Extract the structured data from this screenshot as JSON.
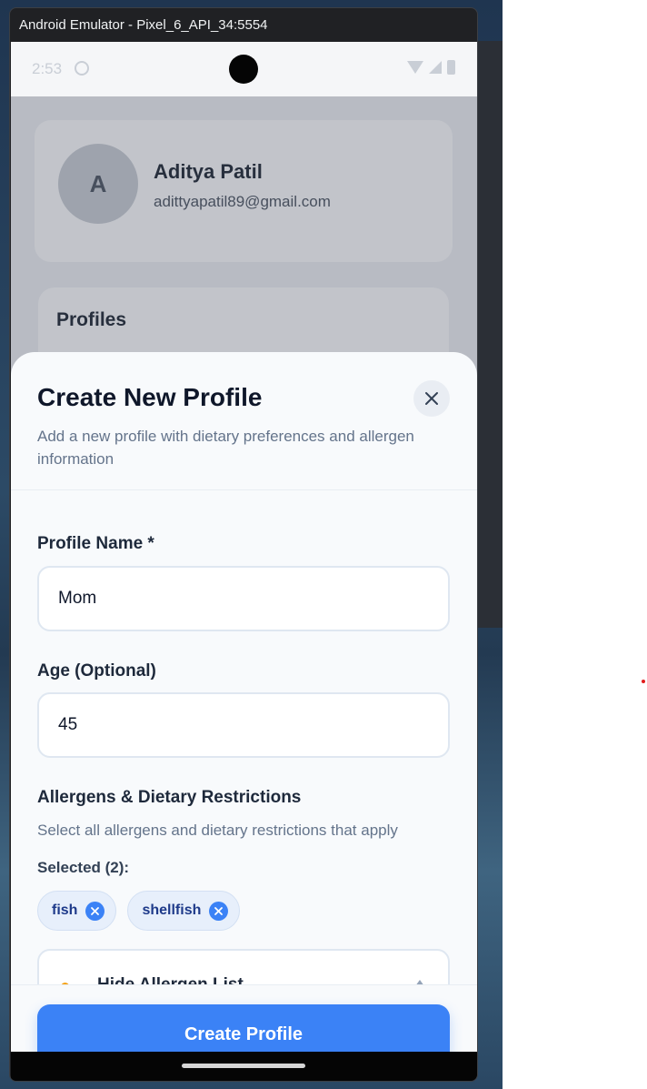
{
  "window": {
    "title": "Android Emulator - Pixel_6_API_34:5554"
  },
  "status_bar": {
    "time": "2:53",
    "wifi_icon": "wifi-icon",
    "signal_icon": "signal-icon",
    "battery_icon": "battery-icon"
  },
  "background_screen": {
    "avatar_initial": "A",
    "user_name": "Aditya Patil",
    "user_email": "adittyapatil89@gmail.com",
    "profiles_heading": "Profiles"
  },
  "modal": {
    "title": "Create New Profile",
    "subtitle": "Add a new profile with dietary preferences and allergen information",
    "close_icon": "close-icon",
    "profile_name": {
      "label": "Profile Name *",
      "value": "Mom"
    },
    "age": {
      "label": "Age (Optional)",
      "value": "45"
    },
    "allergens": {
      "heading": "Allergens & Dietary Restrictions",
      "helper": "Select all allergens and dietary restrictions that apply",
      "selected_label": "Selected (2):",
      "selected": [
        "fish",
        "shellfish"
      ],
      "toggle_label": "Hide Allergen List",
      "toggle_icon": "drumstick-icon"
    },
    "submit_label": "Create Profile"
  },
  "colors": {
    "primary": "#3b82f6",
    "chip_bg": "#e7effb",
    "chip_text": "#1e3a8a",
    "title_text": "#0f172a",
    "muted_text": "#64748b"
  }
}
